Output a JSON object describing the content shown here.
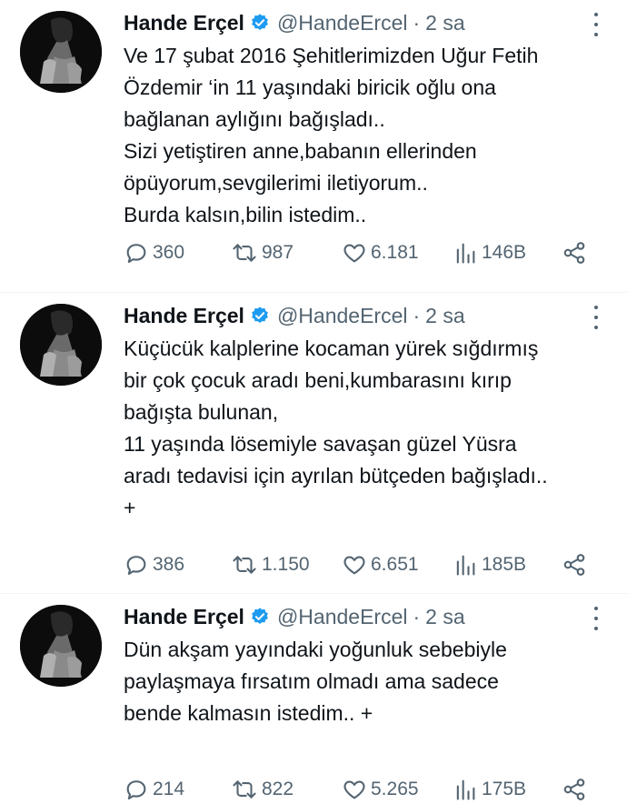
{
  "tweets": [
    {
      "name": "Hande Erçel",
      "handle": "@HandeErcel",
      "dot": "·",
      "time": "2 sa",
      "lines": [
        "Ve 17 şubat 2016 Şehitlerimizden Uğur Fetih",
        "Özdemir ‘in 11 yaşındaki biricik oğlu ona",
        "bağlanan aylığını bağışladı..",
        "Sizi yetiştiren anne,babanın ellerinden",
        "öpüyorum,sevgilerimi iletiyorum..",
        "Burda kalsın,bilin istedim.."
      ],
      "replies": "360",
      "retweets": "987",
      "likes": "6.181",
      "views": "146B"
    },
    {
      "name": "Hande Erçel",
      "handle": "@HandeErcel",
      "dot": "·",
      "time": "2 sa",
      "lines": [
        "Küçücük kalplerine kocaman yürek sığdırmış",
        "bir çok çocuk aradı beni,kumbarasını kırıp",
        "bağışta bulunan,",
        "11 yaşında lösemiyle savaşan güzel Yüsra",
        "aradı tedavisi için ayrılan bütçeden bağışladı..",
        "+"
      ],
      "replies": "386",
      "retweets": "1.150",
      "likes": "6.651",
      "views": "185B"
    },
    {
      "name": "Hande Erçel",
      "handle": "@HandeErcel",
      "dot": "·",
      "time": "2 sa",
      "lines": [
        "Dün akşam yayındaki yoğunluk sebebiyle",
        "paylaşmaya fırsatım olmadı ama sadece",
        "bende kalmasın istedim.. +"
      ],
      "replies": "214",
      "retweets": "822",
      "likes": "5.265",
      "views": "175B"
    }
  ],
  "icons": {
    "verified": "verified-badge-icon",
    "more": "more-vertical-icon",
    "reply": "reply-bubble-icon",
    "retweet": "retweet-icon",
    "like": "heart-icon",
    "views": "views-bar-chart-icon",
    "share": "share-icon"
  },
  "colors": {
    "verified": "#1d9bf0",
    "text": "#0f1419",
    "muted": "#536471",
    "divider": "#eff3f4"
  }
}
